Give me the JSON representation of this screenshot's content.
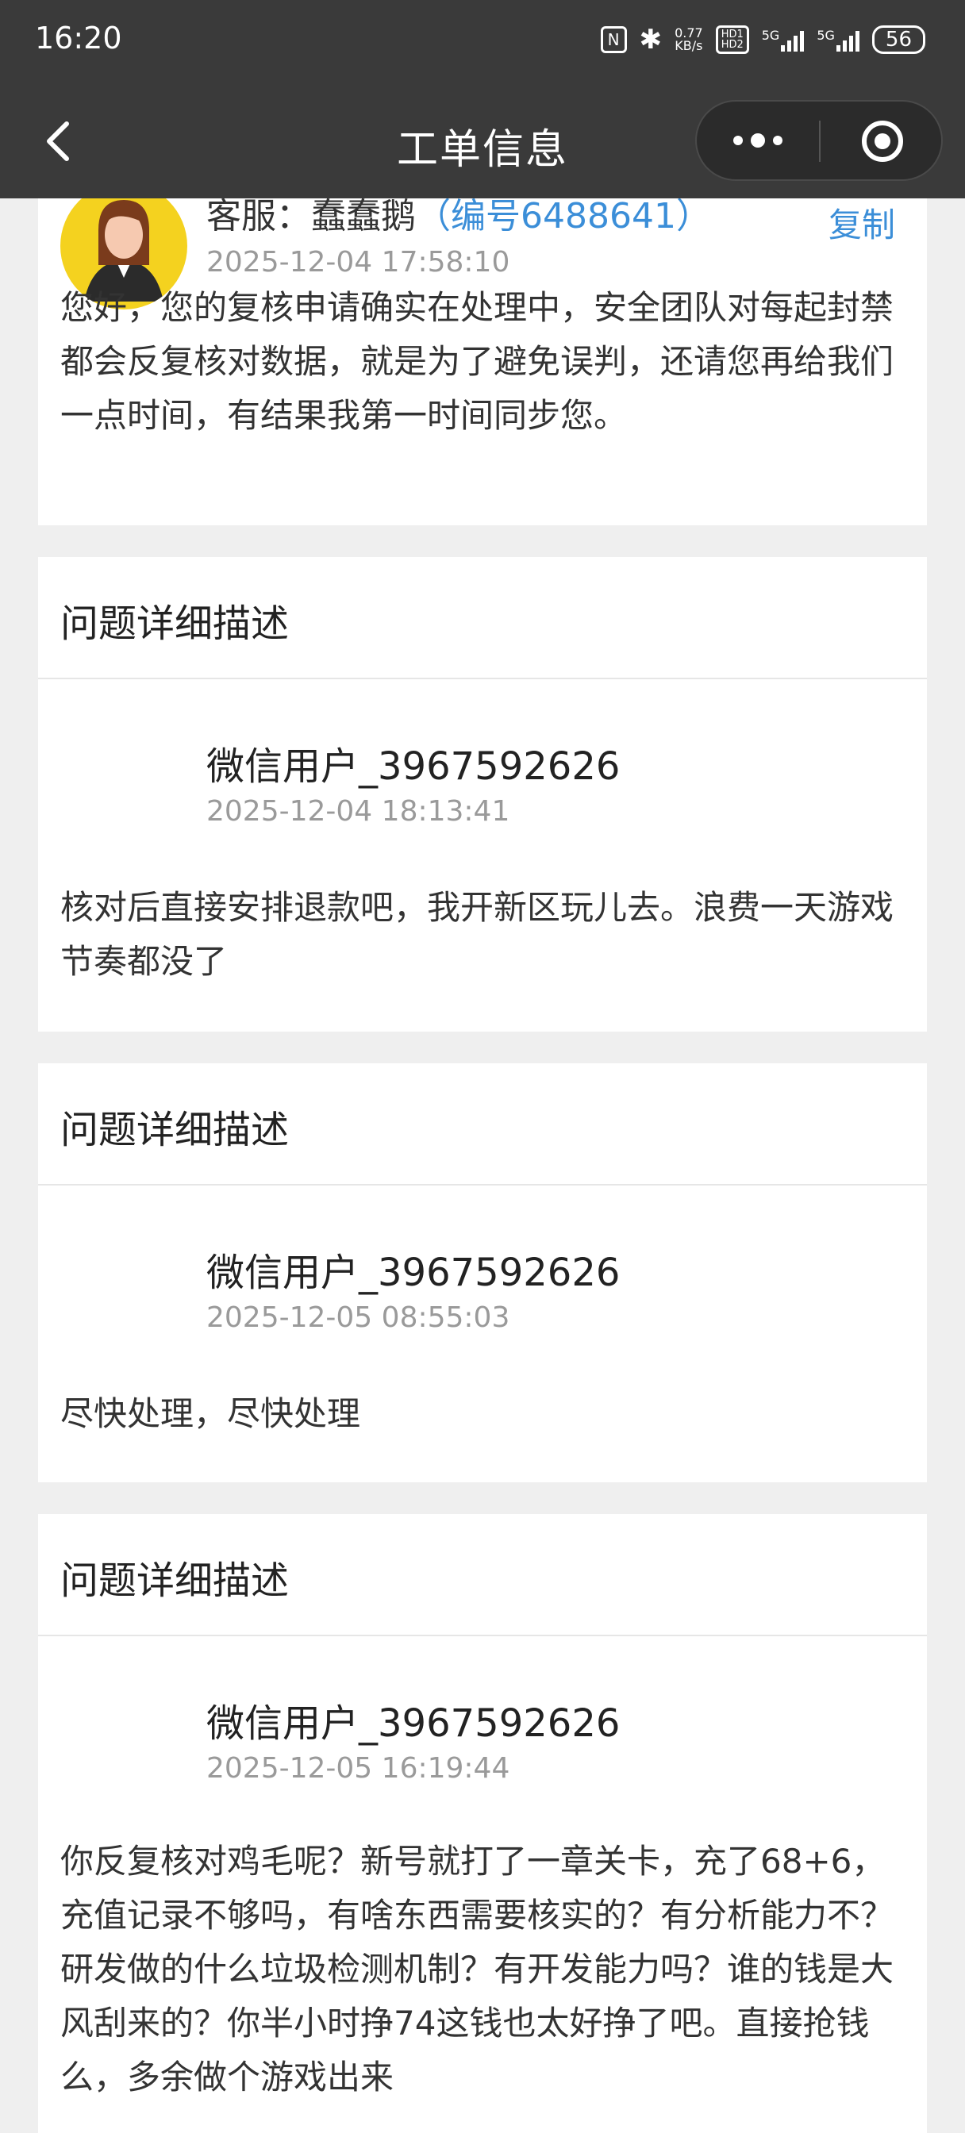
{
  "status_bar": {
    "time": "16:20",
    "speed": "0.77\nKB/s",
    "hd": "HD1\nHD2",
    "net1": "5G",
    "net2": "5G",
    "battery": "56"
  },
  "header": {
    "title": "工单信息"
  },
  "agent_reply": {
    "label": "客服：",
    "name": "蠢蠢鹅",
    "code": "（编号6488641）",
    "copy_label": "复制",
    "datetime": "2025-12-04 17:58:10",
    "message": "您好，您的复核申请确实在处理中，安全团队对每起封禁都会反复核对数据，就是为了避免误判，还请您再给我们一点时间，有结果我第一时间同步您。"
  },
  "entries": [
    {
      "section_title": "问题详细描述",
      "user": "微信用户_3967592626",
      "datetime": "2025-12-04 18:13:41",
      "message": "核对后直接安排退款吧，我开新区玩儿去。浪费一天游戏节奏都没了"
    },
    {
      "section_title": "问题详细描述",
      "user": "微信用户_3967592626",
      "datetime": "2025-12-05 08:55:03",
      "message": "尽快处理，尽快处理"
    },
    {
      "section_title": "问题详细描述",
      "user": "微信用户_3967592626",
      "datetime": "2025-12-05 16:19:44",
      "message": "你反复核对鸡毛呢？新号就打了一章关卡，充了68+6，充值记录不够吗，有啥东西需要核实的？有分析能力不？研发做的什么垃圾检测机制？有开发能力吗？谁的钱是大风刮来的？你半小时挣74这钱也太好挣了吧。直接抢钱么，多余做个游戏出来"
    }
  ],
  "colors": {
    "header_bg": "#3a3a3a",
    "link_blue": "#3b8ed8",
    "page_bg": "#efefef",
    "avatar_bg": "#f4d21f"
  }
}
